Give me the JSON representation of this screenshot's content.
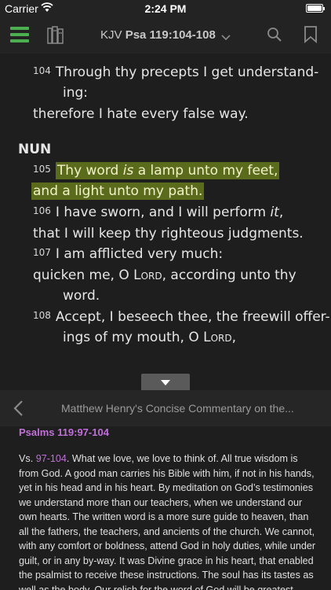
{
  "status": {
    "carrier": "Carrier",
    "time": "2:24 PM"
  },
  "toolbar": {
    "version": "KJV",
    "reference": "Psa 119:104-108"
  },
  "colors": {
    "accent": "#4caf50",
    "highlight": "#5a6b1c",
    "link": "#c070d8"
  },
  "icons": [
    "menu-icon",
    "library-icon",
    "chevron-down-icon",
    "search-icon",
    "bookmark-icon",
    "chevron-left-icon",
    "triangle-down-icon"
  ],
  "scripture": {
    "v104": {
      "num": "104",
      "l1": "Through thy precepts I get understand-",
      "l2": "ing:",
      "l3": "therefore I hate every false way."
    },
    "section": "NUN",
    "v105": {
      "num": "105",
      "l1a": "Thy word ",
      "l1b": "is",
      "l1c": " a lamp unto my feet,",
      "l2": "and a light unto my path."
    },
    "v106": {
      "num": "106",
      "l1a": "I have sworn, and I will perform ",
      "l1b": "it",
      "l1c": ",",
      "l2": "that I will keep thy righteous judgments."
    },
    "v107": {
      "num": "107",
      "l1": "I am afflicted very much:",
      "l2a": "quicken me, O ",
      "l2b": "Lord",
      "l2c": ", according unto thy",
      "l3": "word."
    },
    "v108": {
      "num": "108",
      "l1": "Accept, I beseech thee, the freewill offer-",
      "l2a": "ings of my mouth, O ",
      "l2b": "Lord",
      "l2c": ","
    }
  },
  "commentary": {
    "title": "Matthew Henry's Concise Commentary on the...",
    "ref": "Psalms 119:97-104",
    "prefix": "Vs. ",
    "link": "97-104",
    "text": ". What we love, we love to think of. All true wisdom is from God. A good man carries his Bible with him, if not in his hands, yet in his head and in his heart. By meditation on God’s testimonies we understand more than our teachers, when we understand our own hearts. The written word is a more sure guide to heaven, than all the fathers, the teachers, and ancients of the church. We cannot, with any comfort or boldness, attend God in holy duties, while under guilt, or in any by-way. It was Divine grace in his heart, that enabled the psalmist to receive these instructions. The soul has its tastes as well as the body. Our relish for the word of God will be greatest"
  }
}
